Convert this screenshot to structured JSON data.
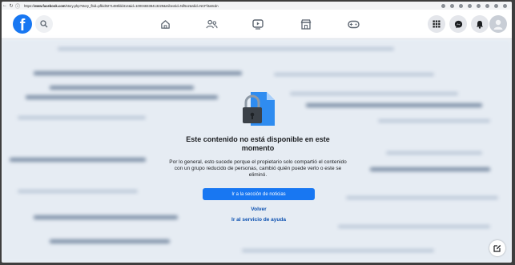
{
  "browser": {
    "url_prefix": "https://",
    "url_host": "www.facebook.com",
    "url_rest": "/story.php?story_fbid=pfbid0271486fdd414&id=100048338413229&mibextid=Nif5oz&rdid=NCFf4a8cdn"
  },
  "nav": {
    "logo": "f",
    "icons": [
      "home-icon",
      "friends-icon",
      "watch-icon",
      "marketplace-icon",
      "gaming-icon"
    ],
    "right_icons": [
      "menu-grid-icon",
      "messenger-icon",
      "notifications-icon",
      "account-avatar"
    ]
  },
  "message": {
    "title": "Este contenido no está disponible en este momento",
    "description": "Por lo general, esto sucede porque el propietario solo compartió el contenido con un grupo reducido de personas, cambió quién puede verlo o este se eliminó.",
    "primary_button": "Ir a la sección de noticias",
    "back_link": "Volver",
    "help_link": "Ir al servicio de ayuda"
  },
  "colors": {
    "brand": "#1877f2",
    "link": "#0a4fb0",
    "text": "#1c1e21"
  }
}
